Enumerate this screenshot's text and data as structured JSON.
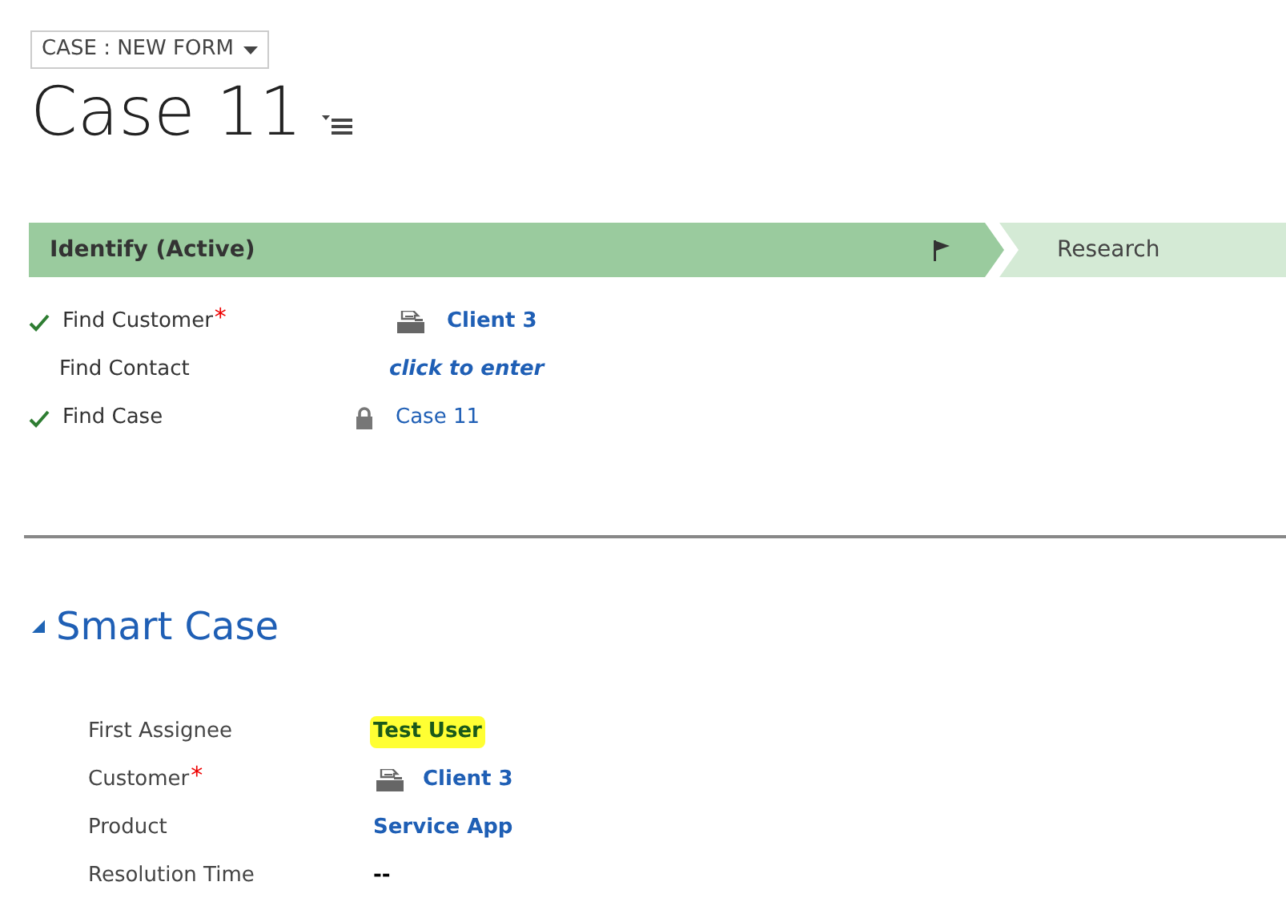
{
  "form_selector": {
    "label": "CASE : NEW FORM"
  },
  "title": "Case 11",
  "process": {
    "stages": [
      {
        "label": "Identify (Active)",
        "selected": true
      },
      {
        "label": "Research",
        "selected": false
      }
    ],
    "steps": [
      {
        "label": "Find Customer",
        "checked": true,
        "required_mark": "*",
        "value": "Client 3",
        "kind": "account"
      },
      {
        "label": "Find Contact",
        "checked": false,
        "value": "click to enter",
        "kind": "placeholder"
      },
      {
        "label": "Find Case",
        "checked": true,
        "value": "Case 11",
        "kind": "locked"
      }
    ]
  },
  "section": {
    "title": "Smart Case",
    "expanded": true,
    "fields": [
      {
        "label": "First Assignee",
        "value": "Test User",
        "kind": "highlighted"
      },
      {
        "label": "Customer",
        "required_mark": "*",
        "value": "Client 3",
        "kind": "account"
      },
      {
        "label": "Product",
        "value": "Service App",
        "kind": "link"
      },
      {
        "label": "Resolution Time",
        "value": "--",
        "kind": "plain"
      }
    ]
  }
}
